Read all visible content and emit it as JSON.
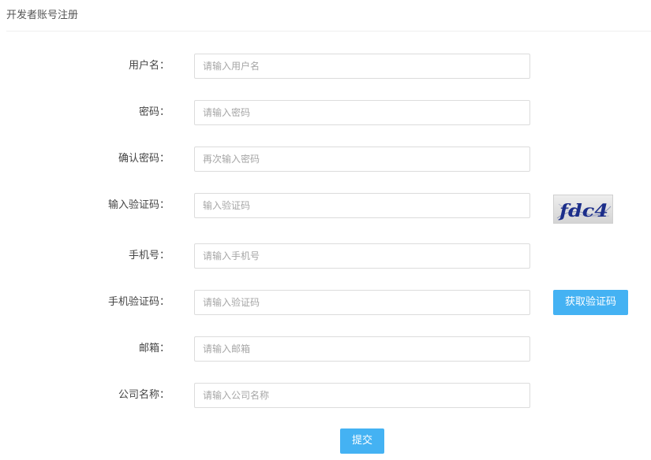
{
  "page": {
    "title": "开发者账号注册"
  },
  "form": {
    "username": {
      "label": "用户名：",
      "placeholder": "请输入用户名",
      "value": ""
    },
    "password": {
      "label": "密码：",
      "placeholder": "请输入密码",
      "value": ""
    },
    "confirm_password": {
      "label": "确认密码：",
      "placeholder": "再次输入密码",
      "value": ""
    },
    "captcha": {
      "label": "输入验证码：",
      "placeholder": "输入验证码",
      "value": "",
      "image_text": "fdc4",
      "image_text_color": "#1c2e8a"
    },
    "phone": {
      "label": "手机号：",
      "placeholder": "请输入手机号",
      "value": ""
    },
    "sms_code": {
      "label": "手机验证码：",
      "placeholder": "请输入验证码",
      "value": "",
      "button_label": "获取验证码"
    },
    "email": {
      "label": "邮箱：",
      "placeholder": "请输入邮箱",
      "value": ""
    },
    "company": {
      "label": "公司名称：",
      "placeholder": "请输入公司名称",
      "value": ""
    },
    "submit_label": "提交"
  },
  "colors": {
    "accent": "#44b2f3",
    "input_border": "#dcdcdc",
    "placeholder": "#a6a6a6",
    "divider": "#eeeeee"
  }
}
